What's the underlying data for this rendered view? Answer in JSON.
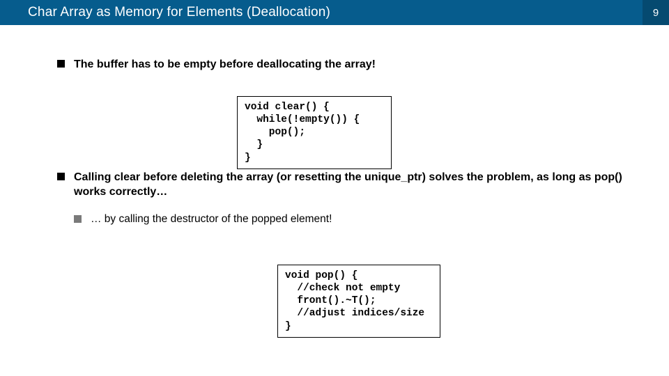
{
  "header": {
    "title": "Char Array as Memory for Elements (Deallocation)",
    "slide_number": "9"
  },
  "bullets": {
    "b1": "The buffer has to be empty before deallocating the array!",
    "b2": "Calling clear before deleting the array (or resetting the unique_ptr) solves the problem, as long as pop() works correctly…",
    "b3": "… by calling the destructor of the popped element!"
  },
  "code": {
    "clear": "void clear() {\n  while(!empty()) {\n    pop();\n  }\n}",
    "pop": "void pop() {\n  //check not empty\n  front().~T();\n  //adjust indices/size\n}"
  }
}
